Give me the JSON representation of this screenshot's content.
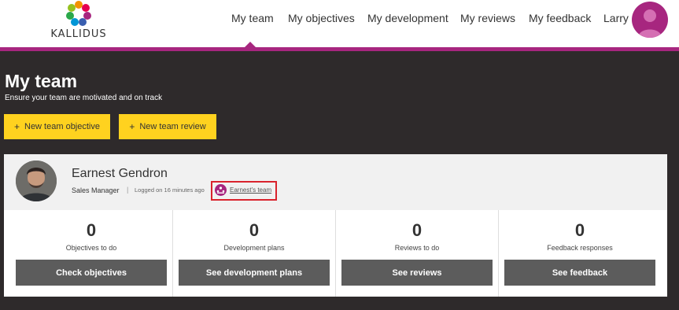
{
  "brand": {
    "logo_text": "KALLIDUS",
    "accent": "#a7267f"
  },
  "nav": {
    "items": [
      {
        "label": "My team",
        "active": true
      },
      {
        "label": "My objectives"
      },
      {
        "label": "My development"
      },
      {
        "label": "My reviews"
      },
      {
        "label": "My feedback"
      }
    ],
    "user_name": "Larry"
  },
  "page": {
    "title": "My team",
    "subtitle": "Ensure your team are motivated and on track",
    "actions": [
      {
        "label": "New team objective",
        "icon": "plus-icon"
      },
      {
        "label": "New team review",
        "icon": "plus-icon"
      }
    ]
  },
  "member": {
    "name": "Earnest Gendron",
    "role": "Sales Manager",
    "separator": "|",
    "last_login": "Logged on 16 minutes ago",
    "team_link": "Earnest's team",
    "stats": [
      {
        "value": "0",
        "label": "Objectives to do",
        "button": "Check objectives"
      },
      {
        "value": "0",
        "label": "Development plans",
        "button": "See development plans"
      },
      {
        "value": "0",
        "label": "Reviews to do",
        "button": "See reviews"
      },
      {
        "value": "0",
        "label": "Feedback responses",
        "button": "See feedback"
      }
    ]
  },
  "colors": {
    "background": "#2e2a2b",
    "button_yellow": "#ffd21f",
    "button_gray": "#5c5c5c",
    "highlight": "#d9232d"
  }
}
